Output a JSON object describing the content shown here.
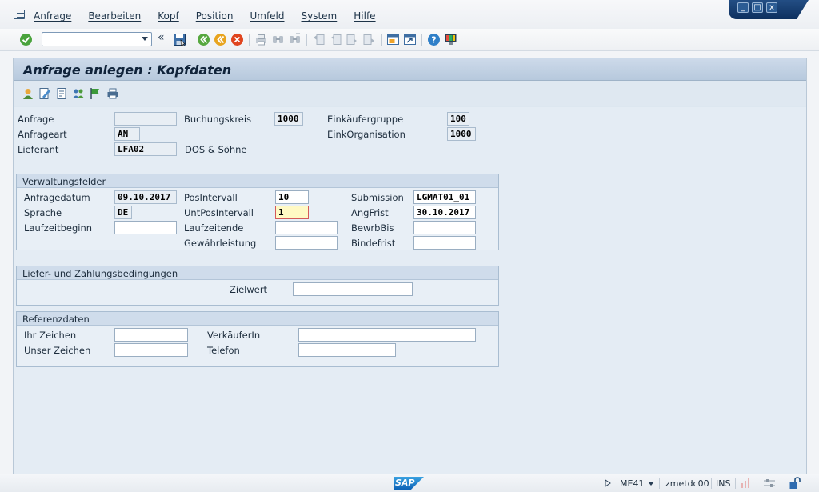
{
  "menu": {
    "items": [
      "Anfrage",
      "Bearbeiten",
      "Kopf",
      "Position",
      "Umfeld",
      "System",
      "Hilfe"
    ]
  },
  "window_controls": {
    "minimize": "_",
    "restore": "□",
    "close": "x"
  },
  "toolbar": {
    "command_field_value": "",
    "back_label": "«",
    "icons": [
      "check-icon",
      "save-icon",
      "back-icon",
      "exit-icon",
      "cancel-icon",
      "print-icon",
      "find-icon",
      "find-next-icon",
      "first-page-icon",
      "previous-page-icon",
      "next-page-icon",
      "last-page-icon",
      "create-session-icon",
      "shortcut-icon",
      "help-icon",
      "customize-layout-icon"
    ]
  },
  "screen": {
    "title": "Anfrage anlegen : Kopfdaten"
  },
  "header_fields": {
    "anfrage": {
      "label": "Anfrage",
      "value": ""
    },
    "anfrageart": {
      "label": "Anfrageart",
      "value": "AN"
    },
    "lieferant": {
      "label": "Lieferant",
      "value": "LFA02",
      "name": "DOS & Söhne"
    },
    "buchungskreis": {
      "label": "Buchungskreis",
      "value": "1000"
    },
    "einkaeufergruppe": {
      "label": "Einkäufergruppe",
      "value": "100"
    },
    "einkorganisation": {
      "label": "EinkOrganisation",
      "value": "1000"
    }
  },
  "verwaltungsfelder": {
    "title": "Verwaltungsfelder",
    "anfragedatum": {
      "label": "Anfragedatum",
      "value": "09.10.2017"
    },
    "sprache": {
      "label": "Sprache",
      "value": "DE"
    },
    "laufzeitbeginn": {
      "label": "Laufzeitbeginn",
      "value": ""
    },
    "posintervall": {
      "label": "PosIntervall",
      "value": "10"
    },
    "untposintervall": {
      "label": "UntPosIntervall",
      "value": "1"
    },
    "laufzeitende": {
      "label": "Laufzeitende",
      "value": ""
    },
    "gewaehrleistung": {
      "label": "Gewährleistung",
      "value": ""
    },
    "submission": {
      "label": "Submission",
      "value": "LGMAT01_01"
    },
    "angfrist": {
      "label": "AngFrist",
      "value": "30.10.2017"
    },
    "bewrbbis": {
      "label": "BewrbBis",
      "value": ""
    },
    "bindefrist": {
      "label": "Bindefrist",
      "value": ""
    }
  },
  "liefer": {
    "title": "Liefer- und Zahlungsbedingungen",
    "zielwert": {
      "label": "Zielwert",
      "value": ""
    }
  },
  "referenz": {
    "title": "Referenzdaten",
    "ihr_zeichen": {
      "label": "Ihr Zeichen",
      "value": ""
    },
    "unser_zeichen": {
      "label": "Unser Zeichen",
      "value": ""
    },
    "verkaeuferin": {
      "label": "VerkäuferIn",
      "value": ""
    },
    "telefon": {
      "label": "Telefon",
      "value": ""
    }
  },
  "statusbar": {
    "transaction": "ME41",
    "system": "zmetdc00",
    "mode": "INS",
    "logo": "SAP"
  }
}
